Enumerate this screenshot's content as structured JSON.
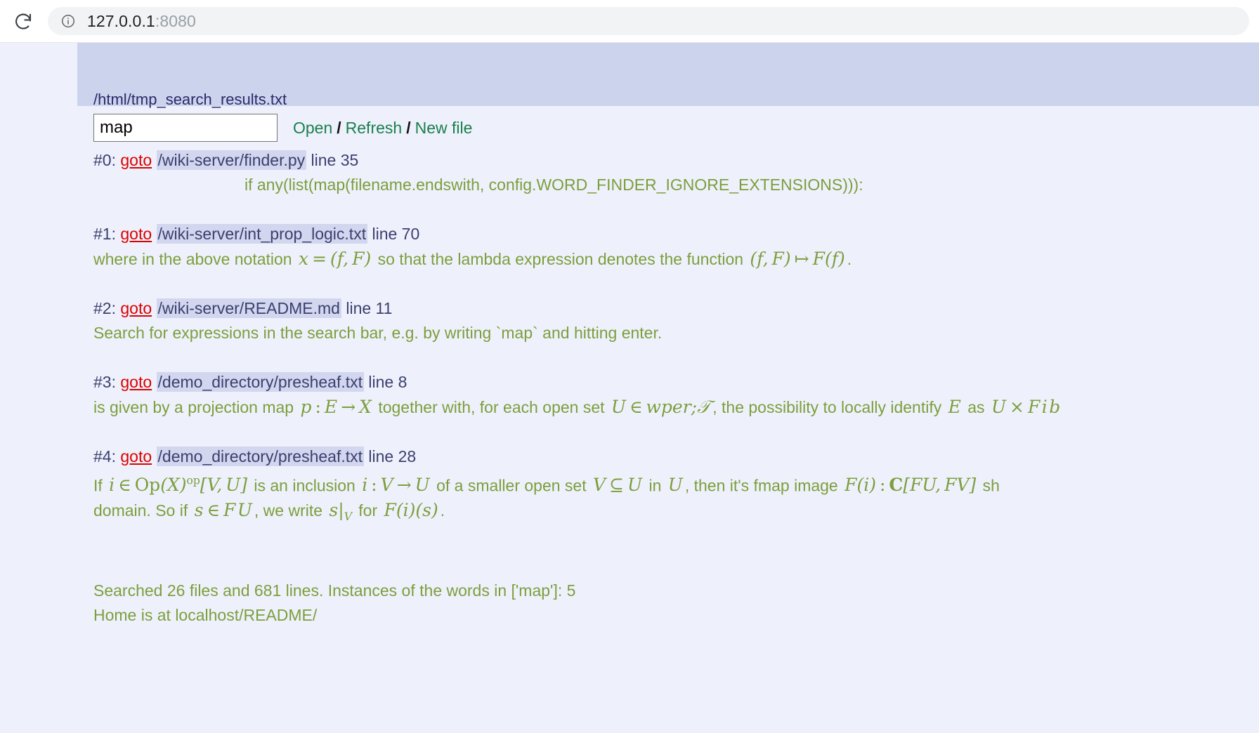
{
  "browser": {
    "reload_icon": "reload-icon",
    "info_icon": "info-circle-icon",
    "url_host": "127.0.0.1",
    "url_port": ":8080"
  },
  "header": {
    "file_path": "/html/tmp_search_results.txt",
    "search_value": "map",
    "search_placeholder": "",
    "links": {
      "open": "Open",
      "refresh": "Refresh",
      "new_file": "New file",
      "separator": "/"
    }
  },
  "results": [
    {
      "index": "#0:",
      "goto": "goto",
      "path": "/wiki-server/finder.py",
      "line_label": "line 35",
      "snippet": "if any(list(map(filename.endswith, config.WORD_FINDER_IGNORE_EXTENSIONS))):",
      "indented": true
    },
    {
      "index": "#1:",
      "goto": "goto",
      "path": "/wiki-server/int_prop_logic.txt",
      "line_label": "line 70",
      "snippet_parts": {
        "a": "where in the above notation",
        "b": "so that the lambda expression denotes the function",
        "c": "."
      },
      "math": {
        "m1": "x = (f, F)",
        "m2": "(f, F) ↦ F(f)"
      }
    },
    {
      "index": "#2:",
      "goto": "goto",
      "path": "/wiki-server/README.md",
      "line_label": "line 11",
      "snippet": "Search for expressions in the search bar, e.g. by writing `map` and hitting enter."
    },
    {
      "index": "#3:",
      "goto": "goto",
      "path": "/demo_directory/presheaf.txt",
      "line_label": "line 8",
      "snippet_parts": {
        "a": "is given by a projection map",
        "b": "together with, for each open set",
        "c": ", the possibility to locally identify",
        "d": "as"
      },
      "math": {
        "m1": "p : E → X",
        "m2": "U ∈ T",
        "m3": "E",
        "m4": "U × Fib"
      }
    },
    {
      "index": "#4:",
      "goto": "goto",
      "path": "/demo_directory/presheaf.txt",
      "line_label": "line 28",
      "snippet_parts": {
        "a": "If",
        "b": "is an inclusion",
        "c": "of a smaller open set",
        "d": "in",
        "e": ", then it's fmap image",
        "f": "sh",
        "g": "domain. So if",
        "h": ", we write",
        "i": "for",
        "j": "."
      },
      "math": {
        "m1": "i ∈ Op(X)op[V, U]",
        "m2": "i : V → U",
        "m3": "V ⊆ U",
        "m4": "U",
        "m5": "F(i) : C[FU, FV]",
        "m6": "s ∈ FU",
        "m7": "s|V",
        "m8": "F(i)(s)"
      }
    }
  ],
  "footer": {
    "summary": "Searched 26 files and 681 lines. Instances of the words in ['map']: 5",
    "home": "Home is at localhost/README/"
  },
  "colors": {
    "page_background": "#eef1fc",
    "header_band": "#ccd3ec",
    "snippet_green": "#7d9e3c",
    "link_green": "#1a7f4b",
    "goto_red": "#dd0000",
    "path_navy": "#3b3f6e",
    "path_highlight": "#d2d6ee",
    "title_navy": "#2a2a6b"
  }
}
